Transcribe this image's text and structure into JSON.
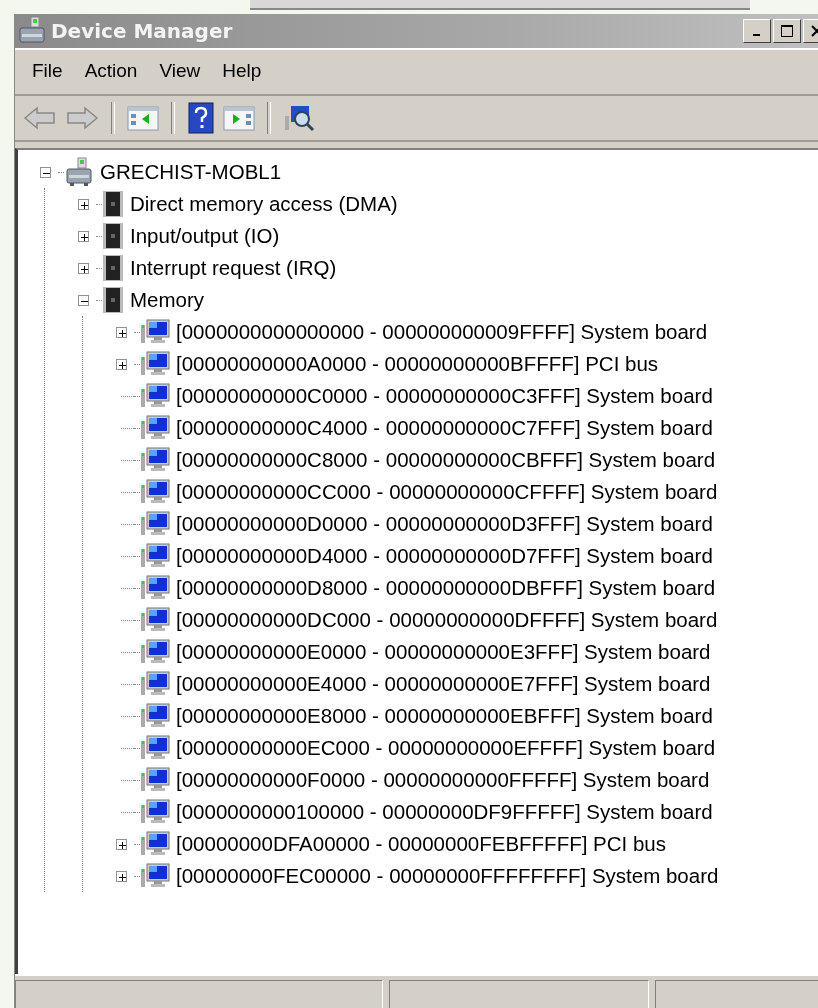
{
  "window": {
    "title": "Device Manager"
  },
  "menu": [
    "File",
    "Action",
    "View",
    "Help"
  ],
  "tree": {
    "label": "GRECHIST-MOBL1",
    "kind": "computer",
    "expanded": true,
    "children": [
      {
        "label": "Direct memory access (DMA)",
        "kind": "chip",
        "expanded": false
      },
      {
        "label": "Input/output (IO)",
        "kind": "chip",
        "expanded": false
      },
      {
        "label": "Interrupt request (IRQ)",
        "kind": "chip",
        "expanded": false
      },
      {
        "label": "Memory",
        "kind": "chip",
        "expanded": true,
        "children": [
          {
            "label": "[0000000000000000 - 000000000009FFFF] System board",
            "kind": "monitor",
            "expanded": false
          },
          {
            "label": "[00000000000A0000 - 00000000000BFFFF] PCI bus",
            "kind": "monitor",
            "expanded": false
          },
          {
            "label": "[00000000000C0000 - 00000000000C3FFF] System board",
            "kind": "monitor"
          },
          {
            "label": "[00000000000C4000 - 00000000000C7FFF] System board",
            "kind": "monitor"
          },
          {
            "label": "[00000000000C8000 - 00000000000CBFFF] System board",
            "kind": "monitor"
          },
          {
            "label": "[00000000000CC000 - 00000000000CFFFF] System board",
            "kind": "monitor"
          },
          {
            "label": "[00000000000D0000 - 00000000000D3FFF] System board",
            "kind": "monitor"
          },
          {
            "label": "[00000000000D4000 - 00000000000D7FFF] System board",
            "kind": "monitor"
          },
          {
            "label": "[00000000000D8000 - 00000000000DBFFF] System board",
            "kind": "monitor"
          },
          {
            "label": "[00000000000DC000 - 00000000000DFFFF] System board",
            "kind": "monitor"
          },
          {
            "label": "[00000000000E0000 - 00000000000E3FFF] System board",
            "kind": "monitor"
          },
          {
            "label": "[00000000000E4000 - 00000000000E7FFF] System board",
            "kind": "monitor"
          },
          {
            "label": "[00000000000E8000 - 00000000000EBFFF] System board",
            "kind": "monitor"
          },
          {
            "label": "[00000000000EC000 - 00000000000EFFFF] System board",
            "kind": "monitor"
          },
          {
            "label": "[00000000000F0000 - 00000000000FFFFF] System board",
            "kind": "monitor"
          },
          {
            "label": "[0000000000100000 - 00000000DF9FFFFF] System board",
            "kind": "monitor"
          },
          {
            "label": "[00000000DFA00000 - 00000000FEBFFFFF] PCI bus",
            "kind": "monitor",
            "expanded": false
          },
          {
            "label": "[00000000FEC00000 - 00000000FFFFFFFF] System board",
            "kind": "monitor",
            "expanded": false
          }
        ]
      }
    ]
  }
}
